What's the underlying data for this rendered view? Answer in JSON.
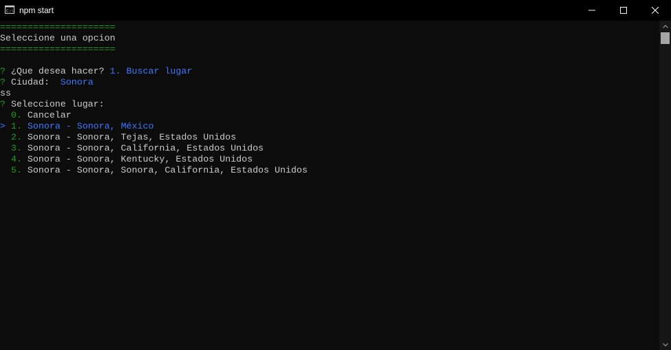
{
  "window": {
    "title": "npm start",
    "icon": "console-icon"
  },
  "terminal": {
    "lines": [
      {
        "parts": [
          {
            "text": "=====================",
            "color": "green"
          }
        ]
      },
      {
        "parts": [
          {
            "text": "Seleccione una opcion",
            "color": "white"
          }
        ]
      },
      {
        "parts": [
          {
            "text": "=====================",
            "color": "green"
          }
        ]
      },
      {
        "parts": [
          {
            "text": "",
            "color": "white"
          }
        ]
      },
      {
        "parts": [
          {
            "text": "? ",
            "color": "green"
          },
          {
            "text": "¿Que desea hacer? ",
            "color": "white"
          },
          {
            "text": "1. Buscar lugar",
            "color": "blue"
          }
        ]
      },
      {
        "parts": [
          {
            "text": "? ",
            "color": "green"
          },
          {
            "text": "Ciudad:  ",
            "color": "white"
          },
          {
            "text": "Sonora",
            "color": "blue"
          }
        ]
      },
      {
        "parts": [
          {
            "text": "ss",
            "color": "white"
          }
        ]
      },
      {
        "parts": [
          {
            "text": "? ",
            "color": "green"
          },
          {
            "text": "Seleccione lugar:",
            "color": "white"
          }
        ]
      },
      {
        "parts": [
          {
            "text": "  0. ",
            "color": "green"
          },
          {
            "text": "Cancelar",
            "color": "white"
          }
        ]
      },
      {
        "parts": [
          {
            "text": "> ",
            "color": "blue"
          },
          {
            "text": "1. ",
            "color": "green"
          },
          {
            "text": "Sonora - Sonora, México",
            "color": "blue"
          }
        ]
      },
      {
        "parts": [
          {
            "text": "  2. ",
            "color": "green"
          },
          {
            "text": "Sonora - Sonora, Tejas, Estados Unidos",
            "color": "white"
          }
        ]
      },
      {
        "parts": [
          {
            "text": "  3. ",
            "color": "green"
          },
          {
            "text": "Sonora - Sonora, California, Estados Unidos",
            "color": "white"
          }
        ]
      },
      {
        "parts": [
          {
            "text": "  4. ",
            "color": "green"
          },
          {
            "text": "Sonora - Sonora, Kentucky, Estados Unidos",
            "color": "white"
          }
        ]
      },
      {
        "parts": [
          {
            "text": "  5. ",
            "color": "green"
          },
          {
            "text": "Sonora - Sonora, Sonora, California, Estados Unidos",
            "color": "white"
          }
        ]
      }
    ]
  },
  "colors": {
    "background": "#0c0c0c",
    "text": "#cccccc",
    "green": "#13a10e",
    "blue": "#3b78ff"
  }
}
